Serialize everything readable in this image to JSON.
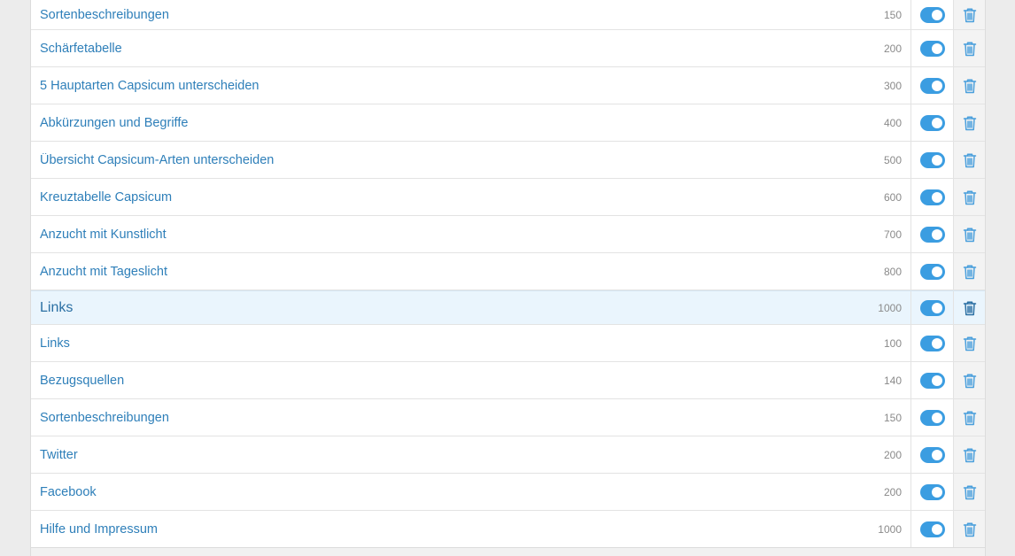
{
  "colors": {
    "accent": "#3b9de1",
    "link_text": "#2e7fb9",
    "group_background": "#eaf5fd",
    "trash_icon": "#4a9fdc",
    "trash_icon_active": "#2a6fa3"
  },
  "rows": [
    {
      "title": "Sortenbeschreibungen",
      "order": "150",
      "enabled": true,
      "type": "item"
    },
    {
      "title": "Schärfetabelle",
      "order": "200",
      "enabled": true,
      "type": "item"
    },
    {
      "title": "5 Hauptarten Capsicum unterscheiden",
      "order": "300",
      "enabled": true,
      "type": "item"
    },
    {
      "title": "Abkürzungen und Begriffe",
      "order": "400",
      "enabled": true,
      "type": "item"
    },
    {
      "title": "Übersicht Capsicum-Arten unterscheiden",
      "order": "500",
      "enabled": true,
      "type": "item"
    },
    {
      "title": "Kreuztabelle Capsicum",
      "order": "600",
      "enabled": true,
      "type": "item"
    },
    {
      "title": "Anzucht mit Kunstlicht",
      "order": "700",
      "enabled": true,
      "type": "item"
    },
    {
      "title": "Anzucht mit Tageslicht",
      "order": "800",
      "enabled": true,
      "type": "item"
    },
    {
      "title": "Links",
      "order": "1000",
      "enabled": true,
      "type": "group"
    },
    {
      "title": "Links",
      "order": "100",
      "enabled": true,
      "type": "item"
    },
    {
      "title": "Bezugsquellen",
      "order": "140",
      "enabled": true,
      "type": "item"
    },
    {
      "title": "Sortenbeschreibungen",
      "order": "150",
      "enabled": true,
      "type": "item"
    },
    {
      "title": "Twitter",
      "order": "200",
      "enabled": true,
      "type": "item"
    },
    {
      "title": "Facebook",
      "order": "200",
      "enabled": true,
      "type": "item"
    },
    {
      "title": "Hilfe und Impressum",
      "order": "1000",
      "enabled": true,
      "type": "item"
    }
  ],
  "icons": {
    "toggle": "toggle-switch-icon",
    "delete": "trash-icon"
  }
}
